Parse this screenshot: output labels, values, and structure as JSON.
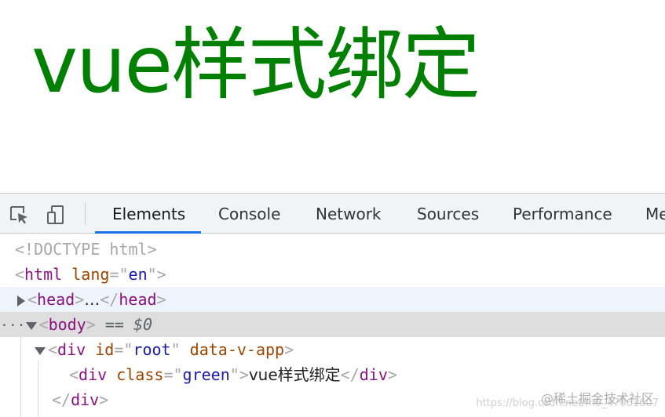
{
  "page": {
    "heading": "vue样式绑定",
    "heading_color": "#008000"
  },
  "toolbar": {
    "icons": [
      "element-picker-icon",
      "device-toolbar-icon"
    ],
    "tabs": [
      {
        "label": "Elements",
        "active": true
      },
      {
        "label": "Console"
      },
      {
        "label": "Network"
      },
      {
        "label": "Sources"
      },
      {
        "label": "Performance"
      },
      {
        "label": "Me"
      }
    ],
    "accent": "#1a73e8"
  },
  "dom_tree": {
    "doctype": "<!DOCTYPE html>",
    "html_tag": "html",
    "html_attr_name": "lang",
    "html_attr_value": "en",
    "head_tag": "head",
    "ellipsis": "…",
    "body_tag": "body",
    "body_marker": "== $0",
    "gutter_dots": "···",
    "div_tag": "div",
    "root_attr_id_name": "id",
    "root_attr_id_value": "root",
    "root_attr_flag": "data-v-app",
    "child_attr_name": "class",
    "child_attr_value": "green",
    "child_text": "vue样式绑定"
  },
  "watermark": {
    "text": "@稀土掘金技术社区",
    "url": "https://blog.csdn.net/m0_47061607"
  }
}
